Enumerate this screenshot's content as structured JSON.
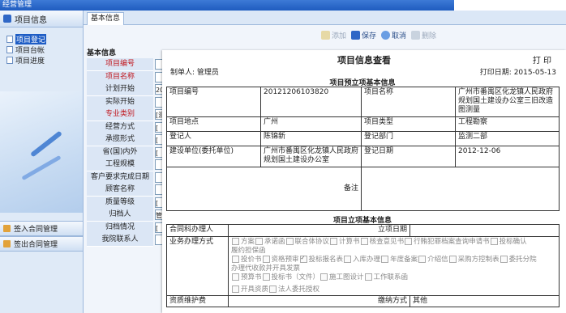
{
  "app": {
    "title": "经营管理"
  },
  "sidebar": {
    "header": "项目信息",
    "items": [
      {
        "label": "项目登记",
        "selected": true
      },
      {
        "label": "项目台帐",
        "selected": false
      },
      {
        "label": "项目进度",
        "selected": false
      }
    ],
    "sections": [
      {
        "label": "签入合同管理"
      },
      {
        "label": "签出合同管理"
      }
    ]
  },
  "tab": {
    "label": "基本信息"
  },
  "toolbar": {
    "add": "添加",
    "save": "保存",
    "cancel": "取消",
    "delete": "删除"
  },
  "form": {
    "section": "基本信息",
    "fields": [
      {
        "label": "项目编号",
        "required": true,
        "value": ""
      },
      {
        "label": "项目名称",
        "required": true,
        "value": ""
      },
      {
        "label": "计划开始",
        "required": false,
        "value": "20"
      },
      {
        "label": "实际开始",
        "required": false,
        "value": ""
      },
      {
        "label": "专业类别",
        "required": true,
        "value": "[测"
      },
      {
        "label": "经营方式",
        "required": false,
        "value": "["
      },
      {
        "label": "承揽形式",
        "required": false,
        "value": "["
      },
      {
        "label": "省(国)内外",
        "required": false,
        "value": "["
      },
      {
        "label": "工程规模",
        "required": false,
        "value": ""
      },
      {
        "label": "客户要求完成日期",
        "required": false,
        "value": ""
      },
      {
        "label": "顾客名称",
        "required": false,
        "value": ""
      },
      {
        "label": "质量等级",
        "required": false,
        "value": "["
      },
      {
        "label": "归档人",
        "required": false,
        "value": "管"
      },
      {
        "label": "归档情况",
        "required": false,
        "value": "["
      },
      {
        "label": "我院联系人",
        "required": false,
        "value": ""
      }
    ]
  },
  "report": {
    "title": "项目信息查看",
    "print_label": "打 印",
    "maker_label": "制单人:",
    "maker": "管理员",
    "print_date_label": "打印日期:",
    "print_date": "2015-05-13",
    "section1": "项目预立项基本信息",
    "rows": [
      {
        "l1": "项目编号",
        "v1": "20121206103820",
        "l2": "项目名称",
        "v2": "广州市番禺区化龙镇人民政府规划国土建设办公室三旧改造图测量"
      },
      {
        "l1": "项目地点",
        "v1": "广州",
        "l2": "项目类型",
        "v2": "工程勘察"
      },
      {
        "l1": "登记人",
        "v1": "陈锦新",
        "l2": "登记部门",
        "v2": "监测二部"
      },
      {
        "l1": "建设单位(委托单位)",
        "v1": "广州市番禺区化龙镇人民政府规划国土建设办公室",
        "l2": "登记日期",
        "v2": "2012-12-06"
      }
    ],
    "remark_label": "备注",
    "section2": "项目立项基本信息",
    "contract_handler_label": "合同科办理人",
    "approval_date_label": "立项日期",
    "business_label": "业务办理方式",
    "options_line1": [
      {
        "label": "方案",
        "checked": false
      },
      {
        "label": "承诺函",
        "checked": false
      },
      {
        "label": "联合体协议",
        "checked": false
      },
      {
        "label": "计算书",
        "checked": false
      },
      {
        "label": "核查意见书",
        "checked": false
      },
      {
        "label": "行贿犯罪档案查询申请书",
        "checked": false
      },
      {
        "label": "投标确认",
        "checked": false
      }
    ],
    "options_line2_text": "履约担保函",
    "options_line3": [
      {
        "label": "投价书",
        "checked": false
      },
      {
        "label": "资格预审",
        "checked": false
      },
      {
        "label": "投标报名表",
        "checked": true
      },
      {
        "label": "入库办理",
        "checked": false
      },
      {
        "label": "年度备案",
        "checked": false
      },
      {
        "label": "介绍信",
        "checked": false
      },
      {
        "label": "采购方控制表",
        "checked": false
      },
      {
        "label": "委托分院",
        "checked": false
      }
    ],
    "options_line4_text": "办理代收款并开具发票",
    "options_line5": [
      {
        "label": "预算书",
        "checked": false
      },
      {
        "label": "投标书（文件）",
        "checked": false
      },
      {
        "label": "施工图设计",
        "checked": false
      },
      {
        "label": "工作联系函",
        "checked": false
      }
    ],
    "options_line6": [
      {
        "label": "开具资质",
        "checked": false
      },
      {
        "label": "法人委托授权",
        "checked": false
      }
    ],
    "bottom_left": "资质维护费",
    "bottom_mid": "缴纳方式",
    "bottom_right": "其他"
  }
}
